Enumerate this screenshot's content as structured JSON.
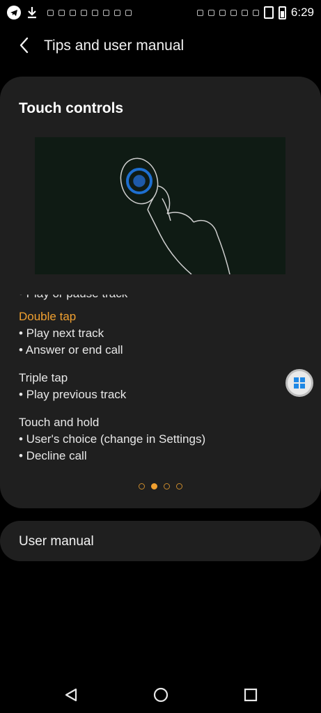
{
  "status_bar": {
    "time": "6:29"
  },
  "app_bar": {
    "title": "Tips and user manual"
  },
  "card": {
    "title": "Touch controls",
    "partial_line": "• Play or pause track",
    "double_tap": {
      "heading": "Double tap",
      "items": [
        "• Play next track",
        "• Answer or end call"
      ]
    },
    "triple_tap": {
      "heading": "Triple tap",
      "items": [
        "• Play previous track"
      ]
    },
    "touch_hold": {
      "heading": "Touch and hold",
      "items": [
        "• User's choice (change in Settings)",
        "• Decline call"
      ]
    },
    "pager": {
      "total": 4,
      "active_index": 1
    }
  },
  "user_manual": {
    "label": "User manual"
  },
  "colors": {
    "accent": "#f0a030",
    "background": "#000000",
    "card": "#1f1f1f"
  },
  "icons": [
    "telegram-icon",
    "download-icon",
    "back-arrow-icon",
    "vibrate-icon",
    "battery-icon",
    "floating-toolbox-icon",
    "nav-back-icon",
    "nav-home-icon",
    "nav-recents-icon"
  ]
}
